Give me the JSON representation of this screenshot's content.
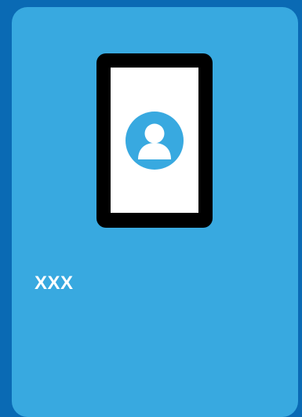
{
  "colors": {
    "page_background": "#0a6ab4",
    "card_background": "#38a9e0",
    "device_frame": "#000000",
    "device_screen": "#ffffff",
    "avatar_background": "#38a9e0",
    "text": "#ffffff"
  },
  "card": {
    "device": {
      "avatar_icon": "user-avatar-icon"
    },
    "title": "XXX"
  }
}
